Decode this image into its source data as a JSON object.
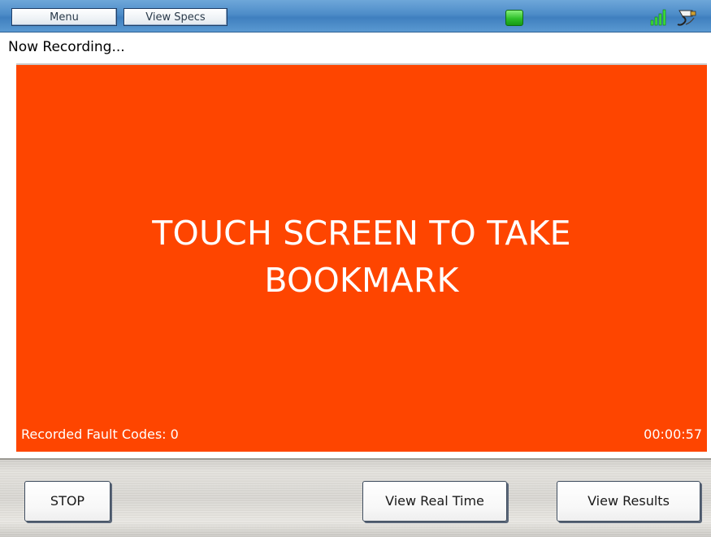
{
  "topbar": {
    "menu_label": "Menu",
    "view_specs_label": "View Specs",
    "status_indicator_color": "#2fc02a",
    "signal_icon": "signal-strength-icon",
    "connection_icon": "plug-cable-icon"
  },
  "status": {
    "recording_text": "Now Recording..."
  },
  "touch_area": {
    "message_line1": "TOUCH SCREEN TO TAKE",
    "message_line2": "BOOKMARK",
    "fault_codes_text": "Recorded Fault Codes: 0",
    "timer": "00:00:57",
    "background_color": "#fe4500"
  },
  "bottombar": {
    "stop_label": "STOP",
    "view_real_time_label": "View Real Time",
    "view_results_label": "View Results"
  }
}
